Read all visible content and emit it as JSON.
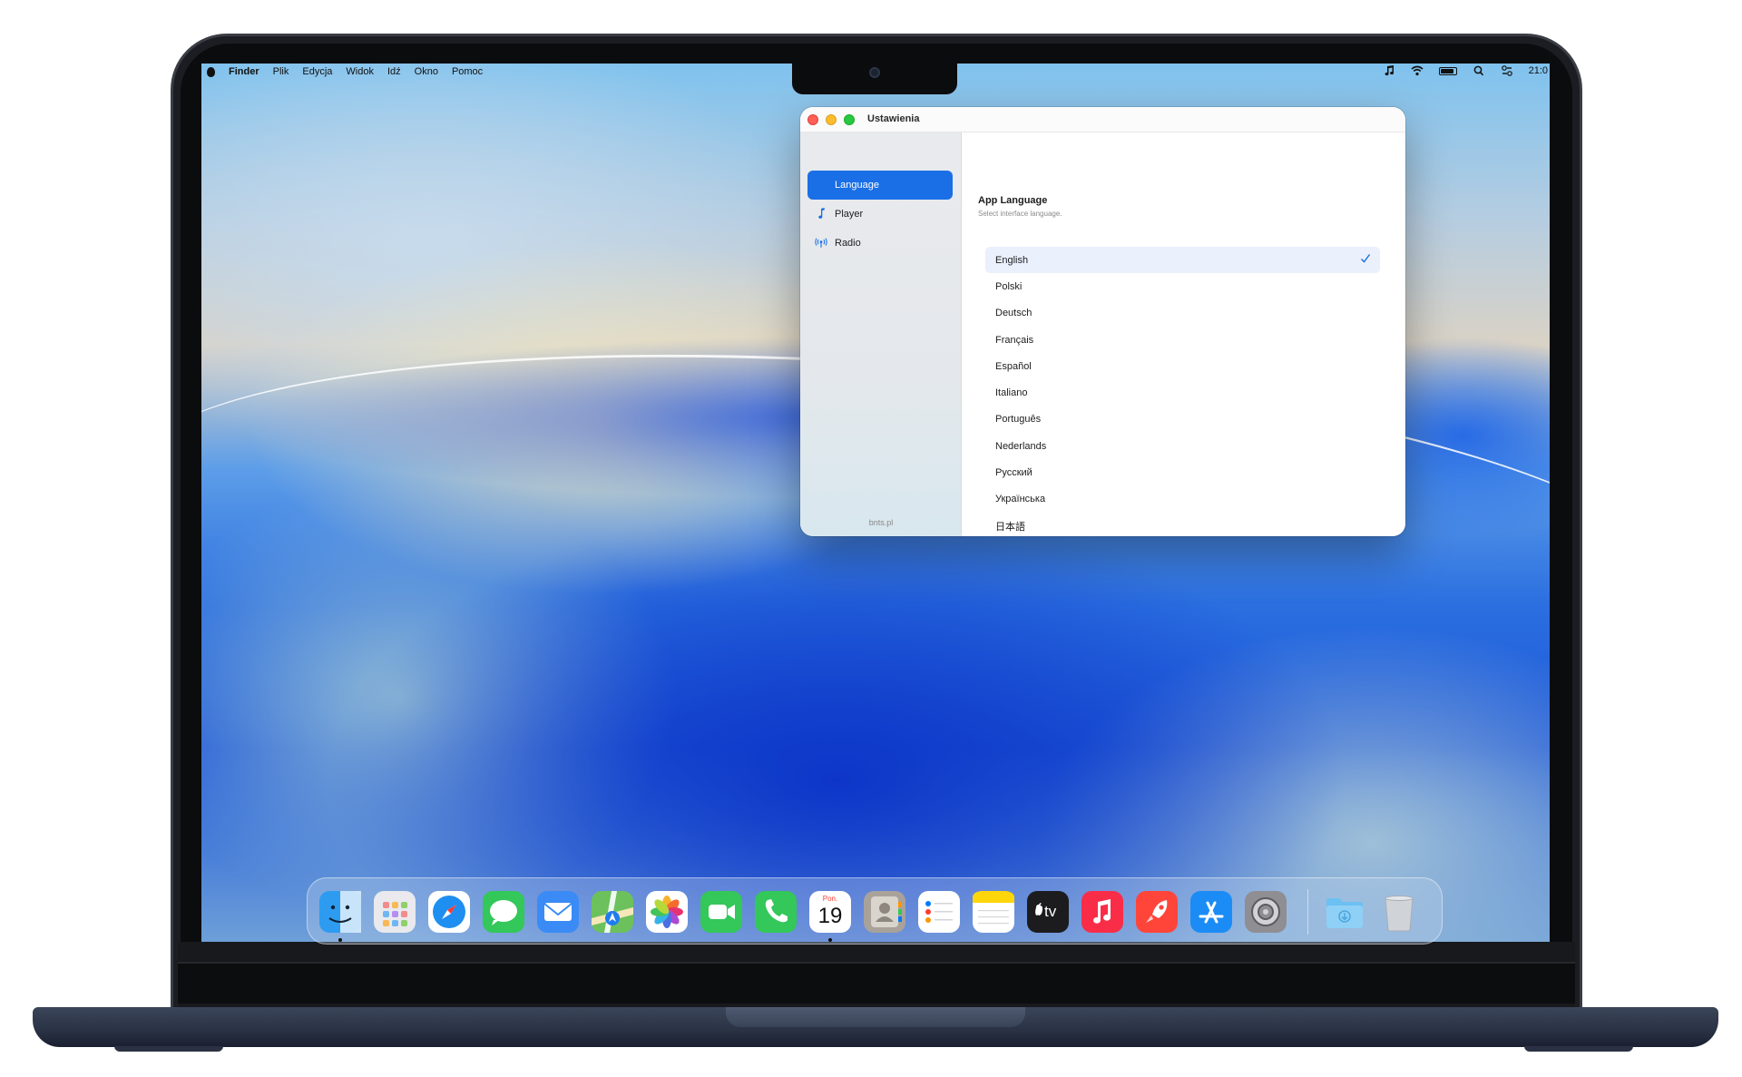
{
  "menubar": {
    "apple_icon": "apple-icon",
    "app_name": "Finder",
    "items": [
      "Plik",
      "Edycja",
      "Widok",
      "Idź",
      "Okno",
      "Pomoc"
    ],
    "clock": "21:0",
    "status_icons": [
      "music-note-icon",
      "wifi-icon",
      "battery-icon",
      "search-icon",
      "control-center-icon"
    ]
  },
  "window": {
    "title": "Ustawienia",
    "sidebar": {
      "items": [
        {
          "label": "Language",
          "icon": "globe-icon",
          "active": true
        },
        {
          "label": "Player",
          "icon": "music-note-icon",
          "active": false
        },
        {
          "label": "Radio",
          "icon": "antenna-icon",
          "active": false
        }
      ],
      "footer": "bnts.pl"
    },
    "content": {
      "title": "App Language",
      "subtitle": "Select interface language.",
      "languages": [
        {
          "label": "English",
          "selected": true
        },
        {
          "label": "Polski",
          "selected": false
        },
        {
          "label": "Deutsch",
          "selected": false
        },
        {
          "label": "Français",
          "selected": false
        },
        {
          "label": "Español",
          "selected": false
        },
        {
          "label": "Italiano",
          "selected": false
        },
        {
          "label": "Português",
          "selected": false
        },
        {
          "label": "Nederlands",
          "selected": false
        },
        {
          "label": "Русский",
          "selected": false
        },
        {
          "label": "Українська",
          "selected": false
        },
        {
          "label": "日本語",
          "selected": false
        }
      ]
    }
  },
  "dock": {
    "apps": [
      {
        "name": "finder-icon",
        "color": "#2d9cf0"
      },
      {
        "name": "launchpad-icon",
        "color": "#e9e9ee"
      },
      {
        "name": "safari-icon",
        "color": "#1f8ef1"
      },
      {
        "name": "messages-icon",
        "color": "#34c759"
      },
      {
        "name": "mail-icon",
        "color": "#3a8bf5"
      },
      {
        "name": "maps-icon",
        "color": "#6cc15d"
      },
      {
        "name": "photos-icon",
        "color": "#ffffff"
      },
      {
        "name": "facetime-icon",
        "color": "#34c759"
      },
      {
        "name": "phone-icon",
        "color": "#34c759"
      },
      {
        "name": "calendar-icon",
        "color": "#ffffff"
      },
      {
        "name": "contacts-icon",
        "color": "#a8a29a"
      },
      {
        "name": "reminders-icon",
        "color": "#ffffff"
      },
      {
        "name": "notes-icon",
        "color": "#ffd60a"
      },
      {
        "name": "apple-tv-icon",
        "color": "#1c1c1e"
      },
      {
        "name": "music-icon",
        "color": "#fa2d48"
      },
      {
        "name": "rocketsim-icon",
        "color": "#ff453a"
      },
      {
        "name": "app-store-icon",
        "color": "#1b8cf5"
      },
      {
        "name": "system-settings-icon",
        "color": "#8e8e93"
      },
      {
        "name": "downloads-folder-icon",
        "color": "#6cc0f2"
      },
      {
        "name": "trash-icon",
        "color": "#d0d4d8"
      }
    ],
    "calendar": {
      "month": "Pon.",
      "day": "19"
    },
    "apple_tv_label": "tv"
  }
}
